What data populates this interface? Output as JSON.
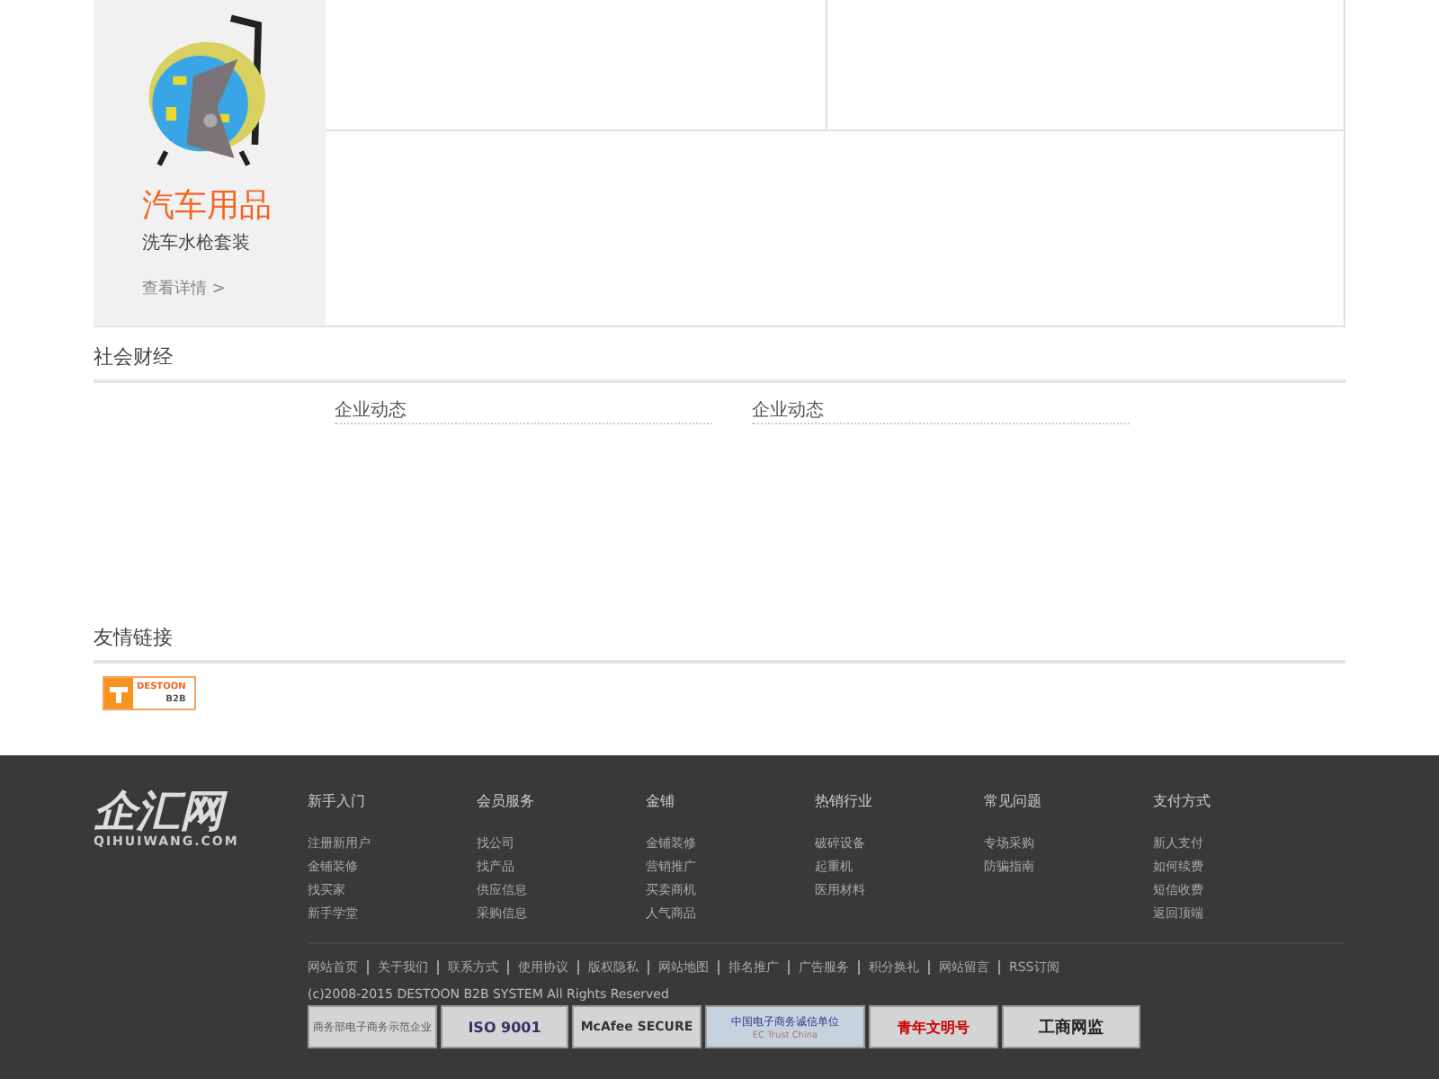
{
  "product_card": {
    "category": "汽车用品",
    "name": "洗车水枪套装",
    "more": "查看详情 >"
  },
  "finance_section": {
    "title": "社会财经",
    "columns": [
      {
        "title": "企业动态"
      },
      {
        "title": "企业动态"
      }
    ]
  },
  "links_section": {
    "title": "友情链接",
    "logo": {
      "name": "DESTOON",
      "sub": "B2B"
    }
  },
  "footer": {
    "logo": {
      "name": "企汇网",
      "domain": "QIHUIWANG.COM"
    },
    "columns": [
      {
        "title": "新手入门",
        "links": [
          "注册新用户",
          "金铺装修",
          "找买家",
          "新手学堂"
        ]
      },
      {
        "title": "会员服务",
        "links": [
          "找公司",
          "找产品",
          "供应信息",
          "采购信息"
        ]
      },
      {
        "title": "金铺",
        "links": [
          "金铺装修",
          "营销推广",
          "买卖商机",
          "人气商品"
        ]
      },
      {
        "title": "热销行业",
        "links": [
          "破碎设备",
          "起重机",
          "医用材料"
        ]
      },
      {
        "title": "常见问题",
        "links": [
          "专场采购",
          "防骗指南"
        ]
      },
      {
        "title": "支付方式",
        "links": [
          "新人支付",
          "如何续费",
          "短信收费",
          "返回顶端"
        ]
      }
    ],
    "nav": [
      "网站首页",
      "关于我们",
      "联系方式",
      "使用协议",
      "版权隐私",
      "网站地图",
      "排名推广",
      "广告服务",
      "积分换礼",
      "网站留言",
      "RSS订阅"
    ],
    "copyright": "(c)2008-2015 DESTOON B2B SYSTEM All Rights Reserved",
    "badges": [
      {
        "kind": "mofcom",
        "text": "商务部电子商务示范企业"
      },
      {
        "kind": "iso",
        "text": "ISO 9001"
      },
      {
        "kind": "mcafee",
        "text": "McAfee SECURE"
      },
      {
        "kind": "ectrust",
        "text": "中国电子商务诚信单位",
        "sub": "EC Trust China"
      },
      {
        "kind": "youth",
        "text": "青年文明号"
      },
      {
        "kind": "gongshang",
        "text": "工商网监"
      }
    ]
  }
}
